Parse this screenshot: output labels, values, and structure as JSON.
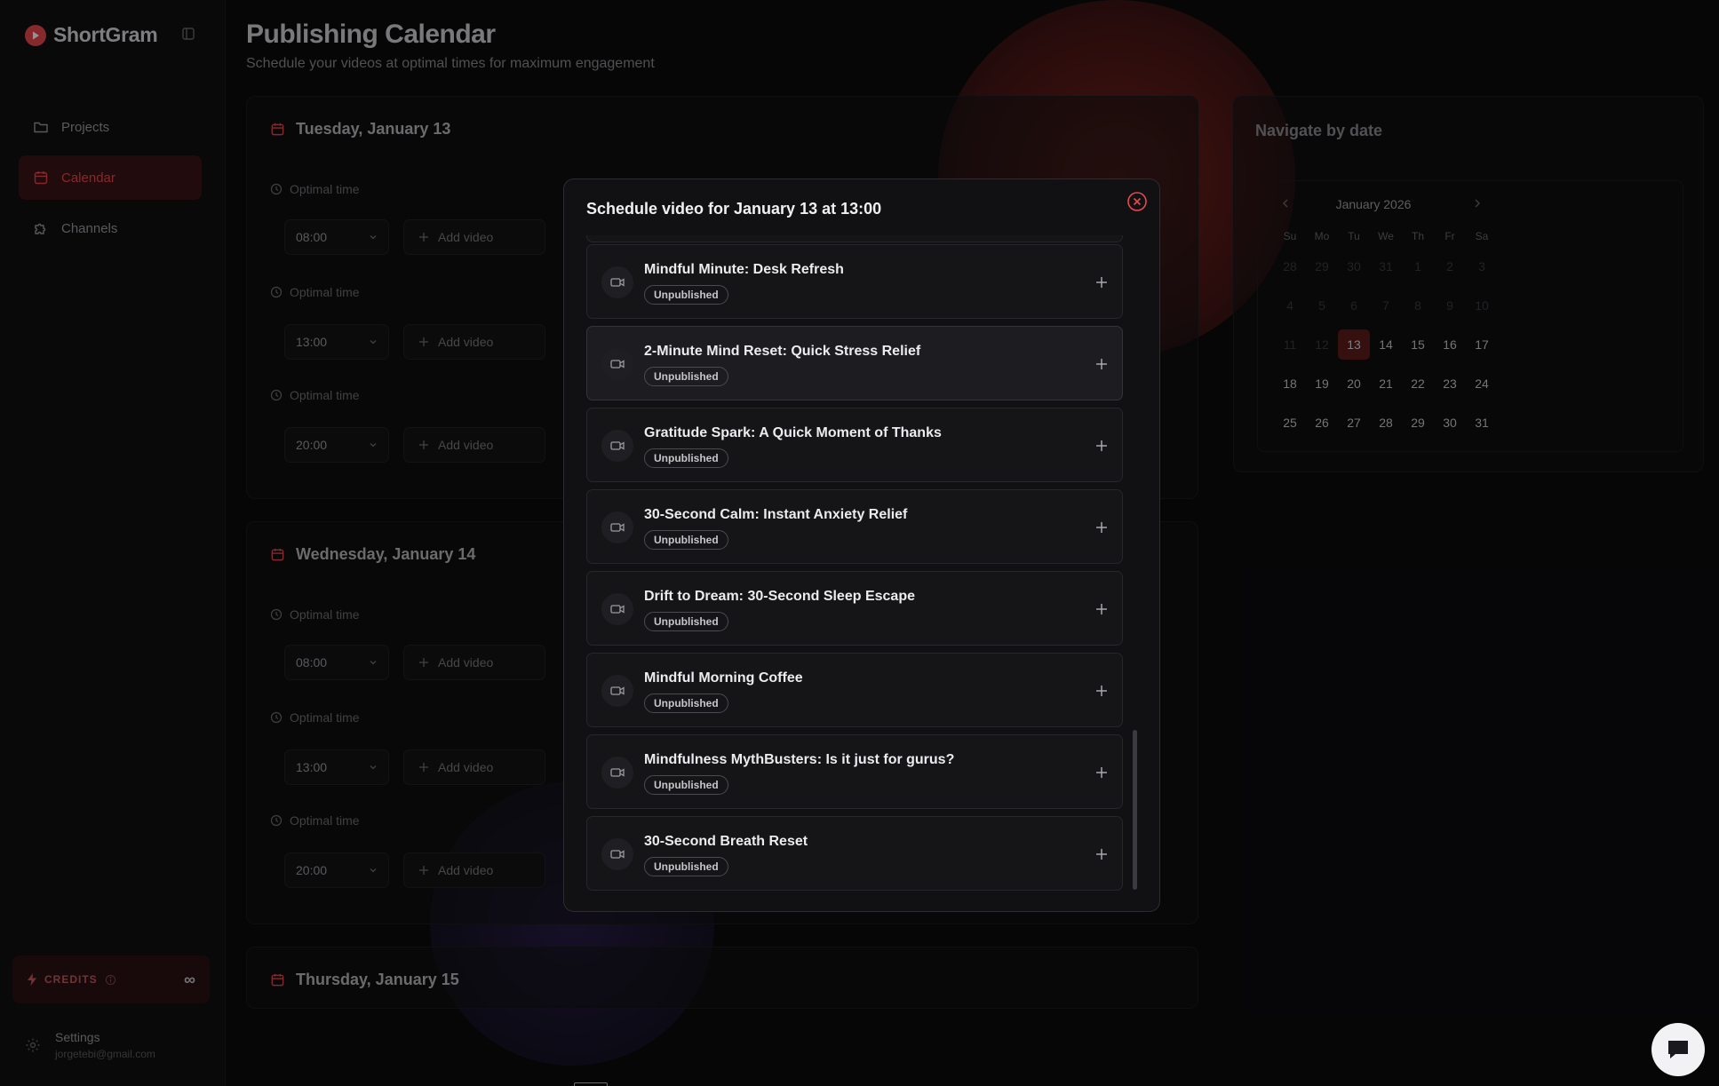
{
  "brand": {
    "name": "ShortGram"
  },
  "sidebar": {
    "items": [
      {
        "label": "Projects",
        "icon": "folder-icon",
        "active": false
      },
      {
        "label": "Calendar",
        "icon": "calendar-icon",
        "active": true
      },
      {
        "label": "Channels",
        "icon": "puzzle-icon",
        "active": false
      }
    ],
    "credits": {
      "label": "CREDITS",
      "value": "∞"
    },
    "settings": {
      "title": "Settings",
      "email": "jorgetebi@gmail.com"
    }
  },
  "main": {
    "title": "Publishing Calendar",
    "subtitle": "Schedule your videos at optimal times for maximum engagement",
    "days": [
      {
        "title": "Tuesday, January 13",
        "slots": [
          {
            "label": "Optimal time",
            "time": "08:00",
            "add": "Add video"
          },
          {
            "label": "Optimal time",
            "time": "13:00",
            "add": "Add video"
          },
          {
            "label": "Optimal time",
            "time": "20:00",
            "add": "Add video"
          }
        ]
      },
      {
        "title": "Wednesday, January 14",
        "slots": [
          {
            "label": "Optimal time",
            "time": "08:00",
            "add": "Add video"
          },
          {
            "label": "Optimal time",
            "time": "13:00",
            "add": "Add video"
          },
          {
            "label": "Optimal time",
            "time": "20:00",
            "add": "Add video"
          }
        ]
      },
      {
        "title": "Thursday, January 15"
      }
    ]
  },
  "navigator": {
    "title": "Navigate by date",
    "month": "January 2026",
    "weekdays": [
      "Su",
      "Mo",
      "Tu",
      "We",
      "Th",
      "Fr",
      "Sa"
    ],
    "weeks": [
      [
        "28",
        "29",
        "30",
        "31",
        "1",
        "2",
        "3"
      ],
      [
        "4",
        "5",
        "6",
        "7",
        "8",
        "9",
        "10"
      ],
      [
        "11",
        "12",
        "13",
        "14",
        "15",
        "16",
        "17"
      ],
      [
        "18",
        "19",
        "20",
        "21",
        "22",
        "23",
        "24"
      ],
      [
        "25",
        "26",
        "27",
        "28",
        "29",
        "30",
        "31"
      ]
    ],
    "selected": "13"
  },
  "modal": {
    "title": "Schedule video for January 13 at 13:00",
    "videos": [
      {
        "title": "Mindful Minute: Desk Refresh",
        "status": "Unpublished"
      },
      {
        "title": "2-Minute Mind Reset: Quick Stress Relief",
        "status": "Unpublished"
      },
      {
        "title": "Gratitude Spark: A Quick Moment of Thanks",
        "status": "Unpublished"
      },
      {
        "title": "30-Second Calm: Instant Anxiety Relief",
        "status": "Unpublished"
      },
      {
        "title": "Drift to Dream: 30-Second Sleep Escape",
        "status": "Unpublished"
      },
      {
        "title": "Mindful Morning Coffee",
        "status": "Unpublished"
      },
      {
        "title": "Mindfulness MythBusters: Is it just for gurus?",
        "status": "Unpublished"
      },
      {
        "title": "30-Second Breath Reset",
        "status": "Unpublished"
      }
    ]
  },
  "colors": {
    "accent": "#e5484d",
    "background": "#0b0b0d",
    "modal": "#111114"
  }
}
